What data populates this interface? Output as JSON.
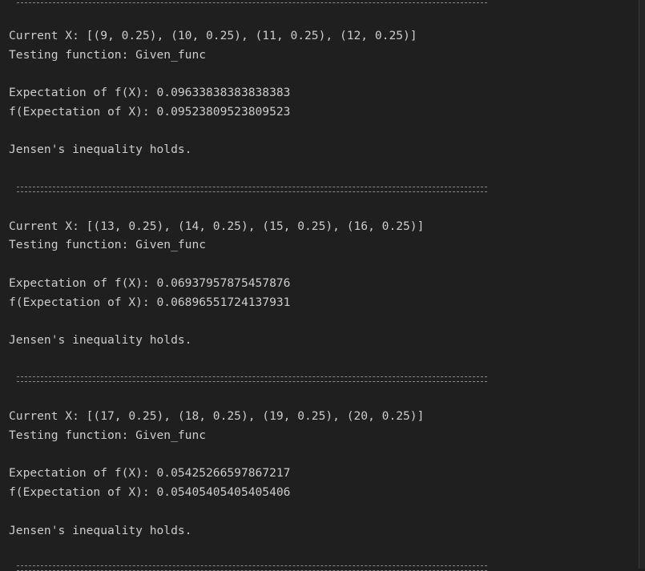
{
  "colors": {
    "background": "#1f1f1f",
    "text": "#cccccc",
    "separator": "#8a8a8a"
  },
  "blocks": [
    {
      "current_x": "Current X: [(9, 0.25), (10, 0.25), (11, 0.25), (12, 0.25)]",
      "testing": "Testing function: Given_func",
      "exp_f": "Expectation of f(X): 0.09633838383838383",
      "f_exp": "f(Expectation of X): 0.09523809523809523",
      "result": "Jensen's inequality holds."
    },
    {
      "current_x": "Current X: [(13, 0.25), (14, 0.25), (15, 0.25), (16, 0.25)]",
      "testing": "Testing function: Given_func",
      "exp_f": "Expectation of f(X): 0.06937957875457876",
      "f_exp": "f(Expectation of X): 0.06896551724137931",
      "result": "Jensen's inequality holds."
    },
    {
      "current_x": "Current X: [(17, 0.25), (18, 0.25), (19, 0.25), (20, 0.25)]",
      "testing": "Testing function: Given_func",
      "exp_f": "Expectation of f(X): 0.05425266597867217",
      "f_exp": "f(Expectation of X): 0.05405405405405406",
      "result": "Jensen's inequality holds."
    }
  ]
}
